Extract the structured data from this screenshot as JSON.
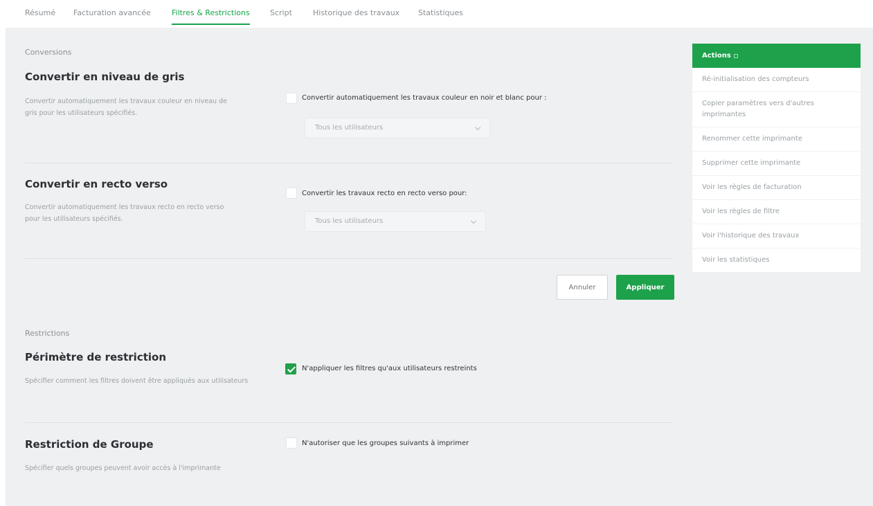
{
  "tabs": [
    {
      "label": "Résumé",
      "active": false
    },
    {
      "label": "Facturation avancée",
      "active": false
    },
    {
      "label": "Filtres & Restrictions",
      "active": true
    },
    {
      "label": "Script",
      "active": false
    },
    {
      "label": "Historique des travaux",
      "active": false
    },
    {
      "label": "Statistiques",
      "active": false
    }
  ],
  "conversions": {
    "section_label": "Conversions",
    "grayscale": {
      "title": "Convertir en niveau de gris",
      "description": "Convertir automatiquement les travaux couleur en niveau de gris pour les utilisateurs spécifiés.",
      "checkbox_label": "Convertir automatiquement les travaux couleur en noir et blanc pour :",
      "checked": false,
      "select_value": "Tous les utilisateurs"
    },
    "duplex": {
      "title": "Convertir en recto verso",
      "description": "Convertir automatiquement les travaux recto en recto verso pour les utilisateurs spécifiés.",
      "checkbox_label": "Convertir les travaux recto en recto verso pour:",
      "checked": false,
      "select_value": "Tous les utilisateurs"
    },
    "cancel_label": "Annuler",
    "apply_label": "Appliquer"
  },
  "restrictions": {
    "section_label": "Restrictions",
    "scope": {
      "title": "Périmètre de restriction",
      "description": "Spécifier comment les filtres doivent être appliqués aux utilisateurs",
      "checkbox_label": "N'appliquer les filtres qu'aux utilisateurs restreints",
      "checked": true
    },
    "group": {
      "title": "Restriction de Groupe",
      "description": "Spécifier quels groupes peuvent avoir accès à l'imprimante",
      "checkbox_label": "N'autoriser que les groupes suivants à imprimer",
      "checked": false
    }
  },
  "actions": {
    "header": "Actions",
    "items": [
      "Ré-initialisation des compteurs",
      "Copier paramètres vers d'autres imprimantes",
      "Renommer cette imprimante",
      "Supprimer cette imprimante",
      "Voir les règles de facturation",
      "Voir les règles de filtre",
      "Voir l'historique des travaux",
      "Voir les statistiques"
    ]
  },
  "colors": {
    "accent": "#1ea14b",
    "background": "#eef0f1"
  }
}
